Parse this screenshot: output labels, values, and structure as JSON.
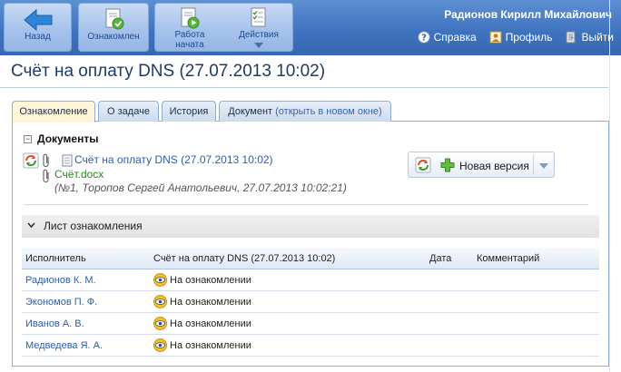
{
  "toolbar": {
    "back_label": "Назад",
    "acknowledged_label": "Ознакомлен",
    "work_started_line1": "Работа",
    "work_started_line2": "начата",
    "actions_label": "Действия"
  },
  "header": {
    "user_name": "Радионов Кирилл Михайлович",
    "help_label": "Справка",
    "profile_label": "Профиль",
    "logout_label": "Выйти"
  },
  "page": {
    "title": "Счёт на оплату DNS (27.07.2013 10:02)"
  },
  "tabs": [
    {
      "label": "Ознакомление",
      "active": true
    },
    {
      "label": "О задаче"
    },
    {
      "label": "История"
    },
    {
      "label": "Документ",
      "extra": "(открыть в новом окне)"
    }
  ],
  "documents": {
    "section_title": "Документы",
    "doc_link": "Счёт на оплату DNS (27.07.2013 10:02)",
    "file_name": "Счёт.docx",
    "meta": "(№1, Торопов Сергей Анатольевич, 27.07.2013 10:02:21)",
    "new_version_label": "Новая версия"
  },
  "acquaintance": {
    "section_title": "Лист ознакомления",
    "columns": {
      "executor": "Исполнитель",
      "document": "Счёт на оплату DNS (27.07.2013 10:02)",
      "date": "Дата",
      "comment": "Комментарий"
    },
    "rows": [
      {
        "name": "Радионов К. М.",
        "status": "На ознакомлении"
      },
      {
        "name": "Экономов П. Ф.",
        "status": "На ознакомлении"
      },
      {
        "name": "Иванов А. В.",
        "status": "На ознакомлении"
      },
      {
        "name": "Медведева Я. А.",
        "status": "На ознакомлении"
      }
    ]
  }
}
